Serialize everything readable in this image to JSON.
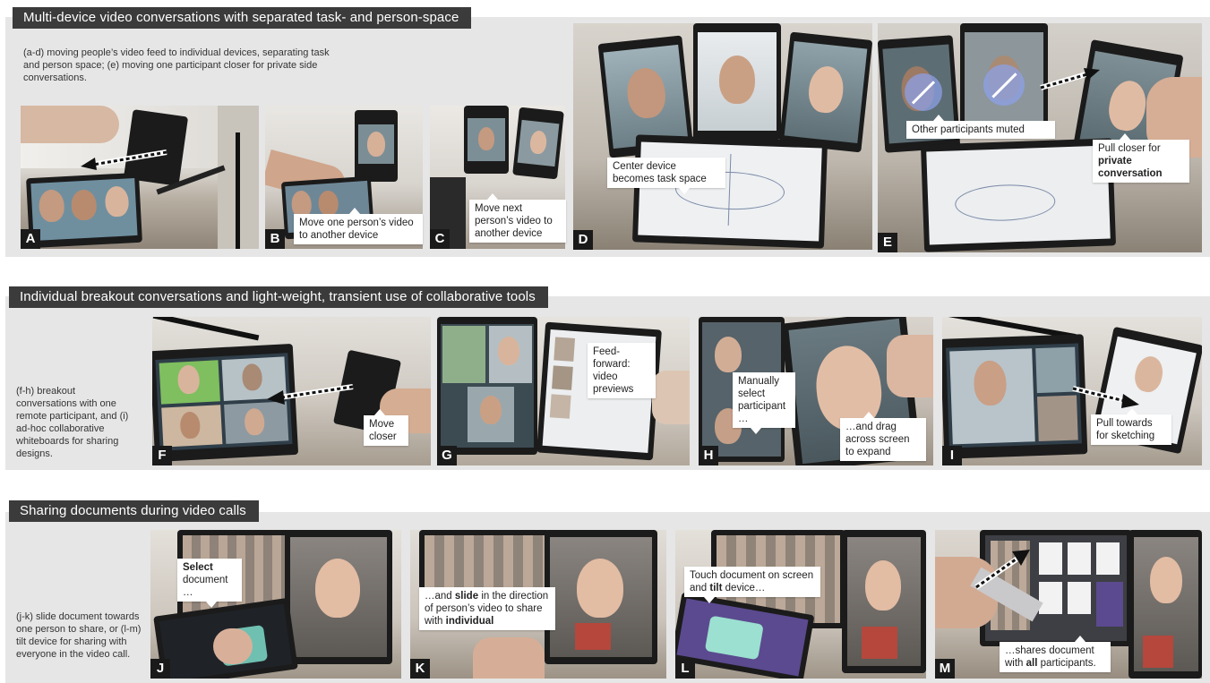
{
  "sections": [
    {
      "title": "Multi-device video conversations with separated task- and person-space",
      "description": "(a-d) moving people’s video feed to individual devices, separating task and person space; (e) moving one participant closer for private side conversations."
    },
    {
      "title": "Individual breakout conversations and light-weight, transient use of collaborative tools",
      "description": "(f-h) breakout conversations with one remote participant, and (i) ad-hoc collaborative whiteboards for sharing designs."
    },
    {
      "title": "Sharing documents during video calls",
      "description": "(j-k) slide document towards one person to share, or (l-m) tilt device for sharing with everyone in the video call."
    }
  ],
  "panels": {
    "A": {
      "label": "A"
    },
    "B": {
      "label": "B",
      "callout": "Move one person’s video to another device"
    },
    "C": {
      "label": "C",
      "callout": "Move next person’s video to another device"
    },
    "D": {
      "label": "D",
      "callout": "Center device becomes task space"
    },
    "E": {
      "label": "E",
      "callout1": "Other participants muted",
      "callout2_pre": "Pull closer for",
      "callout2_bold": "private conversation"
    },
    "F": {
      "label": "F",
      "callout": "Move closer"
    },
    "G": {
      "label": "G",
      "callout": "Feed-forward: video previews"
    },
    "H": {
      "label": "H",
      "callout1": "Manually select participant …",
      "callout2": "…and drag across screen to expand"
    },
    "I": {
      "label": "I",
      "callout": "Pull towards for sketching"
    },
    "J": {
      "label": "J",
      "callout_bold": "Select",
      "callout_rest": "document …"
    },
    "K": {
      "label": "K",
      "callout_pre": "…and",
      "callout_bold1": "slide",
      "callout_mid": "in the direction of person’s video to share with",
      "callout_bold2": "individual"
    },
    "L": {
      "label": "L",
      "callout_pre": "Touch document on screen and",
      "callout_bold": "tilt",
      "callout_post": "device…"
    },
    "M": {
      "label": "M",
      "callout_pre": "…shares document with",
      "callout_bold": "all",
      "callout_post": "participants."
    }
  },
  "colors": {
    "band_bg": "#e6e6e6",
    "title_bg": "#3b3b3b",
    "label_bg": "#1a1a1a"
  }
}
